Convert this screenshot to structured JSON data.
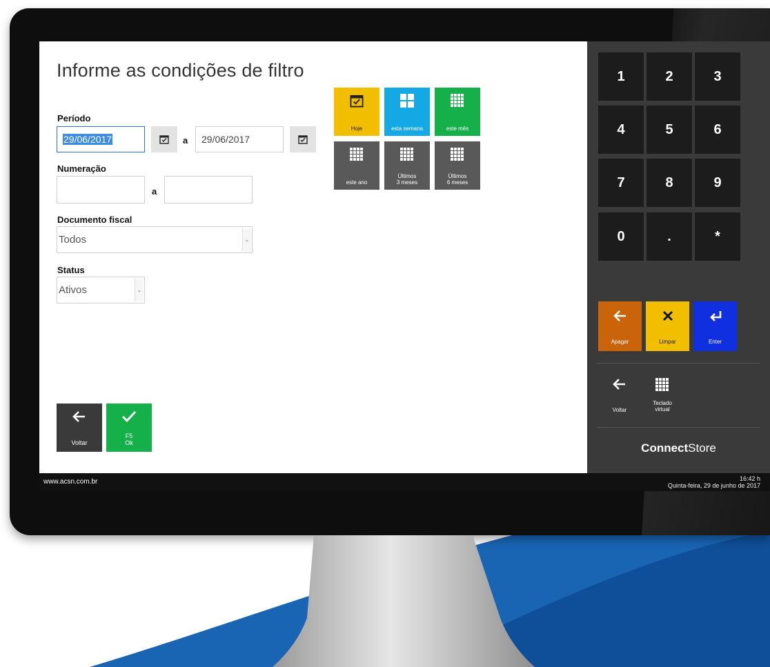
{
  "form": {
    "title": "Informe as condições de filtro",
    "periodo": {
      "label": "Período",
      "from": "29/06/2017",
      "separator": "a",
      "to": "29/06/2017"
    },
    "numeracao": {
      "label": "Numeração",
      "from": "",
      "separator": "a",
      "to": ""
    },
    "documento_fiscal": {
      "label": "Documento fiscal",
      "value": "Todos"
    },
    "status": {
      "label": "Status",
      "value": "Ativos"
    }
  },
  "quick_dates": [
    {
      "label": "Hoje",
      "icon": "calendar-check-icon",
      "color": "#f2be00"
    },
    {
      "label": "esta semana",
      "icon": "grid-2x2-icon",
      "color": "#14a8e4"
    },
    {
      "label": "este mês",
      "icon": "grid-4x4-icon",
      "color": "#16b04a"
    },
    {
      "label": "este ano",
      "icon": "grid-4x4-icon",
      "color": "#595959"
    },
    {
      "label_line1": "Últimos",
      "label_line2": "3 meses",
      "icon": "grid-4x4-icon",
      "color": "#595959"
    },
    {
      "label_line1": "Últimos",
      "label_line2": "6 meses",
      "icon": "grid-4x4-icon",
      "color": "#595959"
    }
  ],
  "actions": {
    "back": {
      "label": "Voltar",
      "icon": "arrow-left-icon",
      "color": "#3a3a3a"
    },
    "ok": {
      "shortcut": "F5",
      "label": "Ok",
      "icon": "checkmark-icon",
      "color": "#16b04a"
    }
  },
  "keypad": {
    "keys": [
      "1",
      "2",
      "3",
      "4",
      "5",
      "6",
      "7",
      "8",
      "9",
      "0",
      ".",
      "*"
    ],
    "apagar": {
      "label": "Apagar",
      "icon": "arrow-left-icon",
      "color": "#c9640a"
    },
    "limpar": {
      "label": "Limpar",
      "icon": "x-icon",
      "color": "#f2be00"
    },
    "enter": {
      "label": "Enter",
      "icon": "enter-return-icon",
      "color": "#0f2fe0"
    },
    "voltar": {
      "label": "Voltar",
      "icon": "arrow-left-icon"
    },
    "teclado": {
      "label_line1": "Teclado",
      "label_line2": "virtual",
      "icon": "grid-4x4-icon"
    },
    "brand_bold": "Connect",
    "brand_light": "Store"
  },
  "statusbar": {
    "url": "www.acsn.com.br",
    "time": "16:42 h",
    "date": "Quinta-feira, 29  de  junho  de  2017"
  }
}
